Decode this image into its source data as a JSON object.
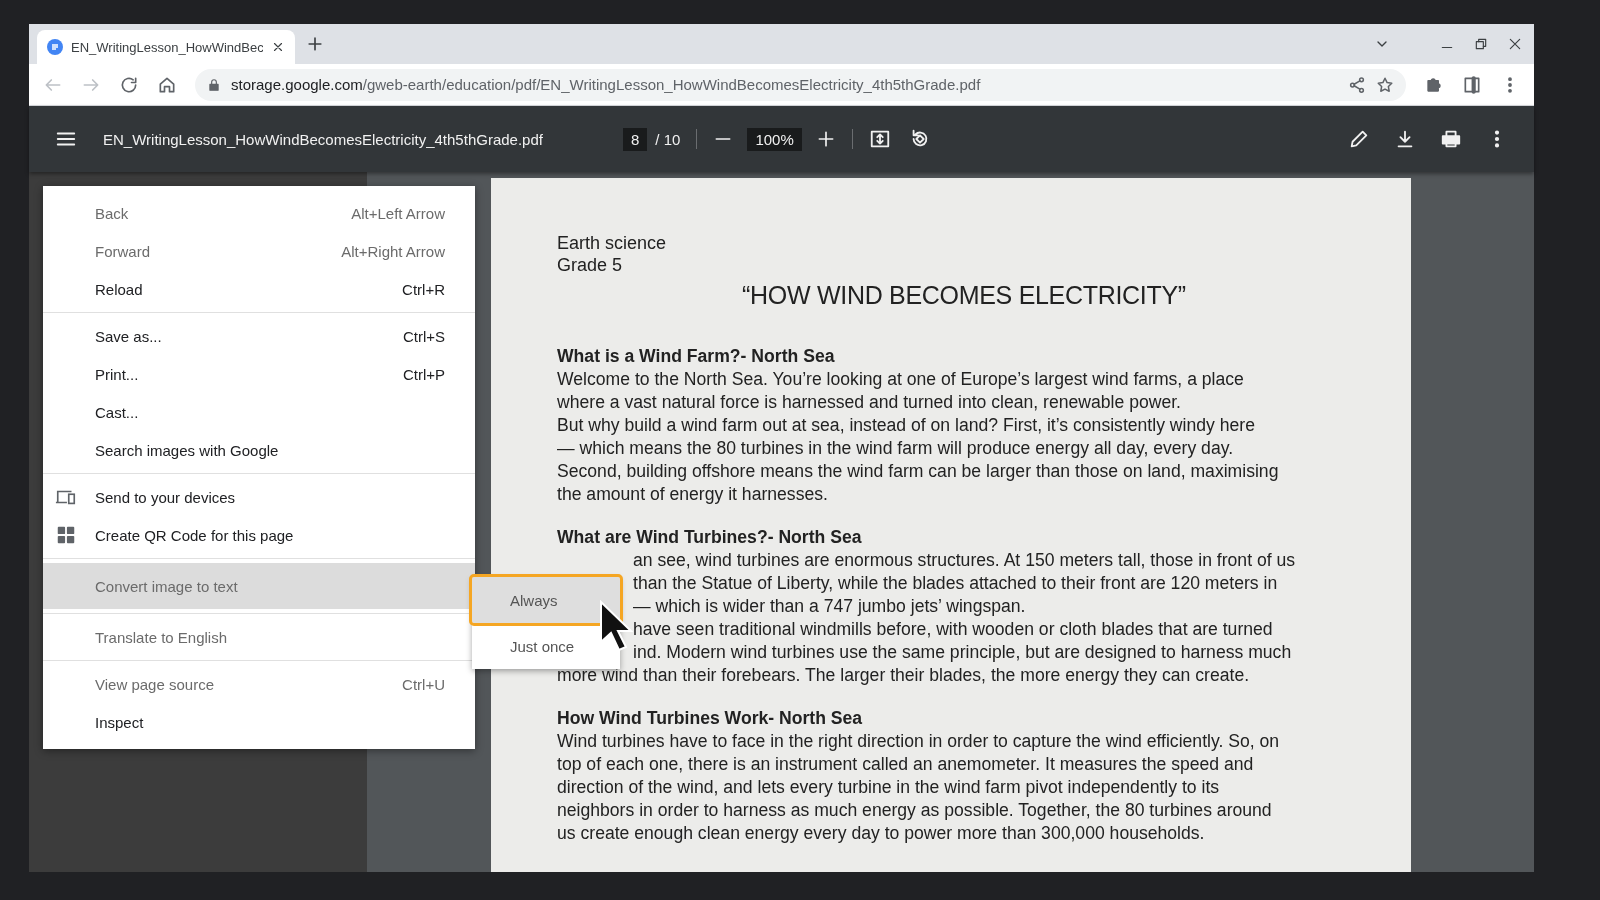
{
  "tabs": [
    {
      "title": "EN_WritingLesson_HowWindBec",
      "selected": true
    }
  ],
  "address_bar": {
    "host": "storage.google.com",
    "path": "/gweb-earth/education/pdf/EN_WritingLesson_HowWindBecomesElectricity_4th5thGrade.pdf"
  },
  "pdf_toolbar": {
    "filename": "EN_WritingLesson_HowWindBecomesElectricity_4th5thGrade.pdf",
    "page": "8",
    "page_total": "/ 10",
    "zoom": "100%"
  },
  "document": {
    "meta": [
      "Earth science",
      "Grade 5"
    ],
    "title": "“HOW WIND BECOMES ELECTRICITY”",
    "sections": [
      {
        "heading": "What is a Wind Farm?- North Sea",
        "lines": [
          {
            "text": "Welcome to the North Sea. You’re looking at one of Europe’s largest wind farms, a place",
            "covered": false
          },
          {
            "text": "where a vast natural force is harnessed and turned into clean, renewable power.",
            "covered": false
          },
          {
            "text": "But why build a wind farm out at sea, instead of on land? First, it’s consistently windy here",
            "covered": false
          },
          {
            "text": "— which means the 80 turbines in the wind farm will produce energy all day, every day.",
            "covered": false
          },
          {
            "text": "Second, building offshore means the wind farm can be larger than those on land, maximising",
            "covered": false
          },
          {
            "text": "the amount of energy it harnesses.",
            "covered": false
          }
        ]
      },
      {
        "heading": "What are Wind Turbines?- North Sea",
        "lines": [
          {
            "text": "an see, wind turbines are enormous structures. At 150 meters tall, those in front of us",
            "covered": true
          },
          {
            "text": "than the Statue of Liberty, while the blades attached to their front are 120 meters in",
            "covered": true
          },
          {
            "text": "— which is wider than a 747 jumbo jets’ wingspan.",
            "covered": true
          },
          {
            "text": "have seen traditional windmills before, with wooden or cloth blades that are turned",
            "covered": true
          },
          {
            "text": "ind. Modern wind turbines use the same principle, but are designed to harness much",
            "covered": true
          },
          {
            "text": "more wind than their forebears. The larger their blades, the more energy they can create.",
            "covered": false
          }
        ]
      },
      {
        "heading": "How Wind Turbines Work- North Sea",
        "lines": [
          {
            "text": "Wind turbines have to face in the right direction in order to capture the wind efficiently. So, on",
            "covered": false
          },
          {
            "text": "top of each one, there is an instrument called an anemometer. It measures the speed and",
            "covered": false
          },
          {
            "text": "direction of the wind, and lets every turbine in the wind farm pivot independently to its",
            "covered": false
          },
          {
            "text": "neighbors in order to harness as much energy as possible. Together, the 80 turbines around",
            "covered": false
          },
          {
            "text": "us create enough clean energy every day to power more than 300,000 households.",
            "covered": false
          }
        ]
      }
    ]
  },
  "context_menu": {
    "groups": [
      [
        {
          "label": "Back",
          "shortcut": "Alt+Left Arrow",
          "kind": "plain",
          "disabled": true,
          "selected": false
        },
        {
          "label": "Forward",
          "shortcut": "Alt+Right Arrow",
          "kind": "plain",
          "disabled": true,
          "selected": false
        },
        {
          "label": "Reload",
          "shortcut": "Ctrl+R",
          "kind": "plain",
          "disabled": false,
          "selected": false
        }
      ],
      [
        {
          "label": "Save as...",
          "shortcut": "Ctrl+S",
          "kind": "plain",
          "disabled": false,
          "selected": false
        },
        {
          "label": "Print...",
          "shortcut": "Ctrl+P",
          "kind": "plain",
          "disabled": false,
          "selected": false
        },
        {
          "label": "Cast...",
          "kind": "plain",
          "disabled": false,
          "selected": false
        },
        {
          "label": "Search images with Google",
          "kind": "plain",
          "disabled": false,
          "selected": false
        }
      ],
      [
        {
          "label": "Send to your devices",
          "kind": "devices",
          "disabled": false,
          "selected": false
        },
        {
          "label": "Create QR Code for this page",
          "kind": "qr",
          "disabled": false,
          "selected": false
        }
      ],
      [
        {
          "label": "Convert image to text",
          "kind": "plain",
          "disabled": true,
          "selected": true
        }
      ],
      [
        {
          "label": "Translate to English",
          "kind": "plain",
          "disabled": true,
          "selected": false
        }
      ],
      [
        {
          "label": "View page source",
          "shortcut": "Ctrl+U",
          "kind": "plain",
          "disabled": true,
          "selected": false
        },
        {
          "label": "Inspect",
          "kind": "plain",
          "disabled": false,
          "selected": false
        }
      ]
    ]
  },
  "submenu": {
    "items": [
      {
        "label": "Always",
        "selected": true
      },
      {
        "label": "Just once",
        "selected": false
      }
    ]
  }
}
